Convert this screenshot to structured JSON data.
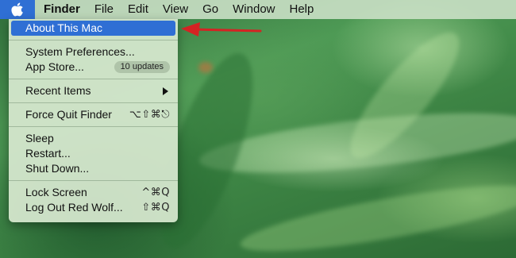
{
  "menubar": {
    "apple_icon": "apple-logo-icon",
    "app_name": "Finder",
    "items": [
      "File",
      "Edit",
      "View",
      "Go",
      "Window",
      "Help"
    ]
  },
  "apple_menu": {
    "about": "About This Mac",
    "system_preferences": "System Preferences...",
    "app_store": "App Store...",
    "app_store_badge": "10 updates",
    "recent_items": "Recent Items",
    "force_quit": "Force Quit Finder",
    "force_quit_shortcut": "⌥⇧⌘⎋",
    "sleep": "Sleep",
    "restart": "Restart...",
    "shut_down": "Shut Down...",
    "lock_screen": "Lock Screen",
    "lock_screen_shortcut": "^⌘Q",
    "log_out": "Log Out Red Wolf...",
    "log_out_shortcut": "⇧⌘Q"
  },
  "colors": {
    "highlight": "#2f6fd4",
    "annotation": "#d42323"
  }
}
